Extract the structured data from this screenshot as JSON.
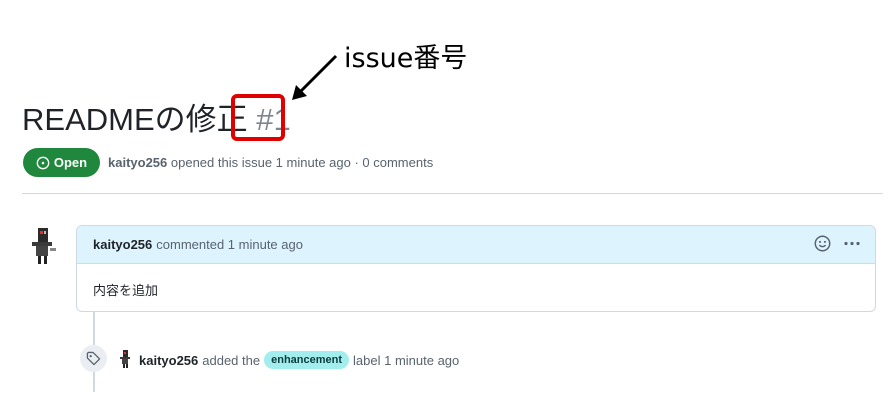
{
  "annotation": {
    "label": "issue番号"
  },
  "issue": {
    "title": "READMEの修正",
    "number": "#1",
    "state": "Open",
    "author": "kaityo256",
    "meta_text": "opened this issue 1 minute ago · 0 comments"
  },
  "comment": {
    "author": "kaityo256",
    "action_time": "commented 1 minute ago",
    "body": "内容を追加"
  },
  "event": {
    "author": "kaityo256",
    "pre": "added the",
    "label_name": "enhancement",
    "post": "label 1 minute ago"
  },
  "colors": {
    "open_badge": "#1f883d",
    "label_bg": "#a2eeef",
    "highlight": "#e00000",
    "comment_header_bg": "#ddf4ff"
  },
  "icons": [
    "arrow-icon",
    "issue-opened-icon",
    "smiley-icon",
    "kebab-icon",
    "tag-icon"
  ]
}
